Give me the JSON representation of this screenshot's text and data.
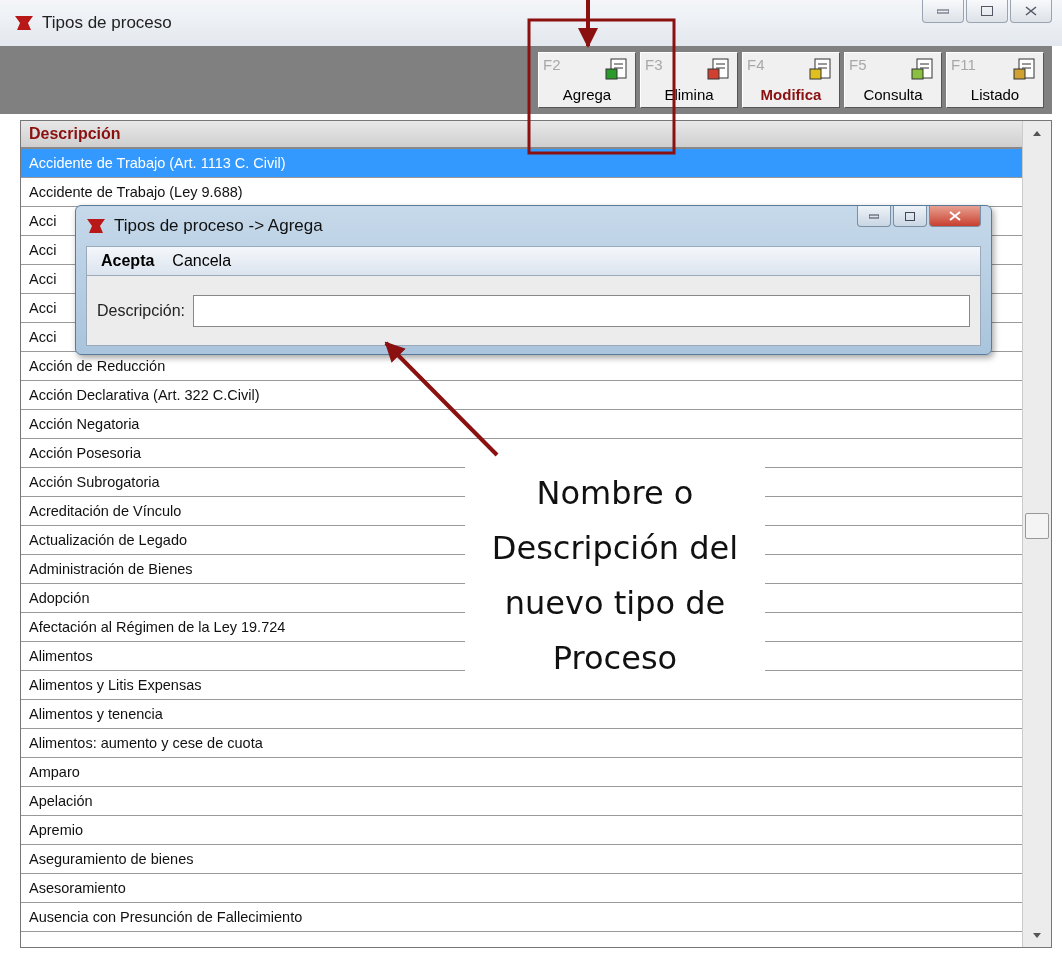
{
  "window": {
    "title": "Tipos de proceso"
  },
  "toolbar": [
    {
      "key": "F2",
      "label": "Agrega",
      "emphasized": false
    },
    {
      "key": "F3",
      "label": "Elimina",
      "emphasized": false
    },
    {
      "key": "F4",
      "label": "Modifica",
      "emphasized": true
    },
    {
      "key": "F5",
      "label": "Consulta",
      "emphasized": false
    },
    {
      "key": "F11",
      "label": "Listado",
      "emphasized": false
    }
  ],
  "table": {
    "columns": [
      "Descripción"
    ],
    "rows": [
      {
        "text": "Accidente de Trabajo (Art. 1113 C. Civil)",
        "selected": true
      },
      {
        "text": "Accidente de Trabajo (Ley 9.688)",
        "selected": false
      },
      {
        "text": "Acci",
        "selected": false
      },
      {
        "text": "Acci",
        "selected": false
      },
      {
        "text": "Acci",
        "selected": false
      },
      {
        "text": "Acci",
        "selected": false
      },
      {
        "text": "Acci",
        "selected": false
      },
      {
        "text": "Acción de Reducción",
        "selected": false
      },
      {
        "text": "Acción Declarativa (Art. 322 C.Civil)",
        "selected": false
      },
      {
        "text": "Acción Negatoria",
        "selected": false
      },
      {
        "text": "Acción Posesoria",
        "selected": false
      },
      {
        "text": "Acción Subrogatoria",
        "selected": false
      },
      {
        "text": "Acreditación de Vínculo",
        "selected": false
      },
      {
        "text": "Actualización de Legado",
        "selected": false
      },
      {
        "text": "Administración de Bienes",
        "selected": false
      },
      {
        "text": "Adopción",
        "selected": false
      },
      {
        "text": "Afectación al Régimen de la Ley 19.724",
        "selected": false
      },
      {
        "text": "Alimentos",
        "selected": false
      },
      {
        "text": "Alimentos y Litis Expensas",
        "selected": false
      },
      {
        "text": "Alimentos y tenencia",
        "selected": false
      },
      {
        "text": "Alimentos: aumento y cese de cuota",
        "selected": false
      },
      {
        "text": "Amparo",
        "selected": false
      },
      {
        "text": "Apelación",
        "selected": false
      },
      {
        "text": "Apremio",
        "selected": false
      },
      {
        "text": "Aseguramiento de bienes",
        "selected": false
      },
      {
        "text": "Asesoramiento",
        "selected": false
      },
      {
        "text": "Ausencia con Presunción de Fallecimiento",
        "selected": false
      }
    ]
  },
  "dialog": {
    "title": "Tipos de proceso -> Agrega",
    "menu": [
      "Acepta",
      "Cancela"
    ],
    "field_label": "Descripción:"
  },
  "annotation": {
    "text": "Nombre o Descripción del nuevo tipo de Proceso"
  }
}
